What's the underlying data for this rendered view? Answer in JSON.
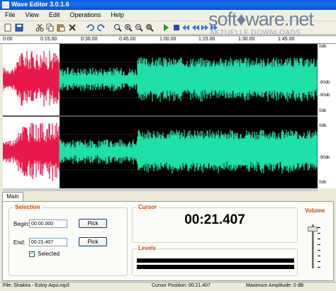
{
  "window": {
    "title": "Wave Editor 3.0.1.6"
  },
  "menu": [
    "File",
    "View",
    "Edit",
    "Operations",
    "Help"
  ],
  "toolbar_icons": [
    "new-icon",
    "save-icon",
    "cut-icon",
    "copy-icon",
    "paste-icon",
    "delete-icon",
    "undo-icon",
    "redo-icon",
    "zoom-selection-icon",
    "zoom-in-icon",
    "zoom-out-icon",
    "zoom-all-icon",
    "play-icon",
    "stop-icon",
    "rewind-start-icon",
    "rewind-icon",
    "forward-icon",
    "forward-end-icon"
  ],
  "watermark": {
    "brand": "soft♦ware.net",
    "tagline": "AKTUELLE DOWNLOADS"
  },
  "ruler": [
    "0:00",
    "0:15.00",
    "0:30.00",
    "0:45.00",
    "1:00.00",
    "1:15.00",
    "1:30.00",
    "1:45.00"
  ],
  "db_scale": [
    "0db",
    "-90db",
    "-90db",
    "0db",
    "0db",
    "-90db",
    "0db"
  ],
  "tabs": [
    {
      "label": "Main",
      "active": true
    }
  ],
  "selection": {
    "title": "Selection",
    "begin_label": "Begin:",
    "begin_value": "00:00.000",
    "end_label": "End:",
    "end_value": "00:21.407",
    "pick_label": "Pick",
    "selected_label": "Selected",
    "selected_checked": true
  },
  "cursor": {
    "title": "Cursor",
    "value": "00:21.407"
  },
  "levels": {
    "title": "Levels"
  },
  "volume": {
    "title": "Volume",
    "level": 0.85
  },
  "status": {
    "file": "File: Shakira - Estoy Aqui.mp3",
    "cursor_position": "Cursor Position: 00:21.407",
    "max_amplitude": "Maximum Amplitude: 0 dB"
  },
  "colors": {
    "selection_wave": "#e8184a",
    "wave": "#1fe0a6",
    "background": "#000000",
    "accent": "#c24a00"
  }
}
